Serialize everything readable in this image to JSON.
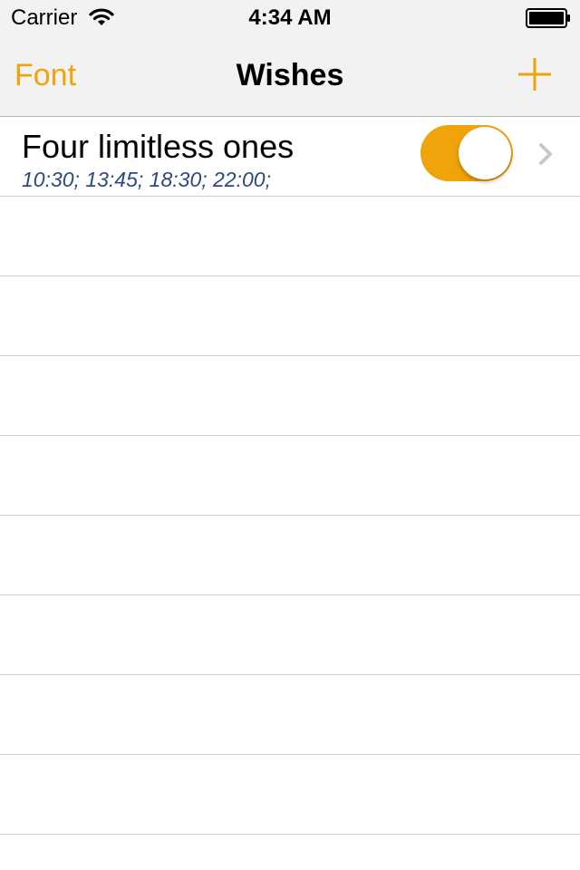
{
  "status_bar": {
    "carrier": "Carrier",
    "time": "4:34 AM",
    "wifi_icon": "wifi-icon",
    "battery_icon": "battery-full-icon"
  },
  "nav": {
    "left_label": "Font",
    "title": "Wishes",
    "right_icon": "plus-icon"
  },
  "colors": {
    "accent": "#f0a30a",
    "subtitle": "#2c4a7c",
    "nav_background": "#f2f2f2"
  },
  "wishes": [
    {
      "title": "Four limitless ones",
      "times": "10:30; 13:45; 18:30; 22:00;",
      "enabled": true
    }
  ]
}
